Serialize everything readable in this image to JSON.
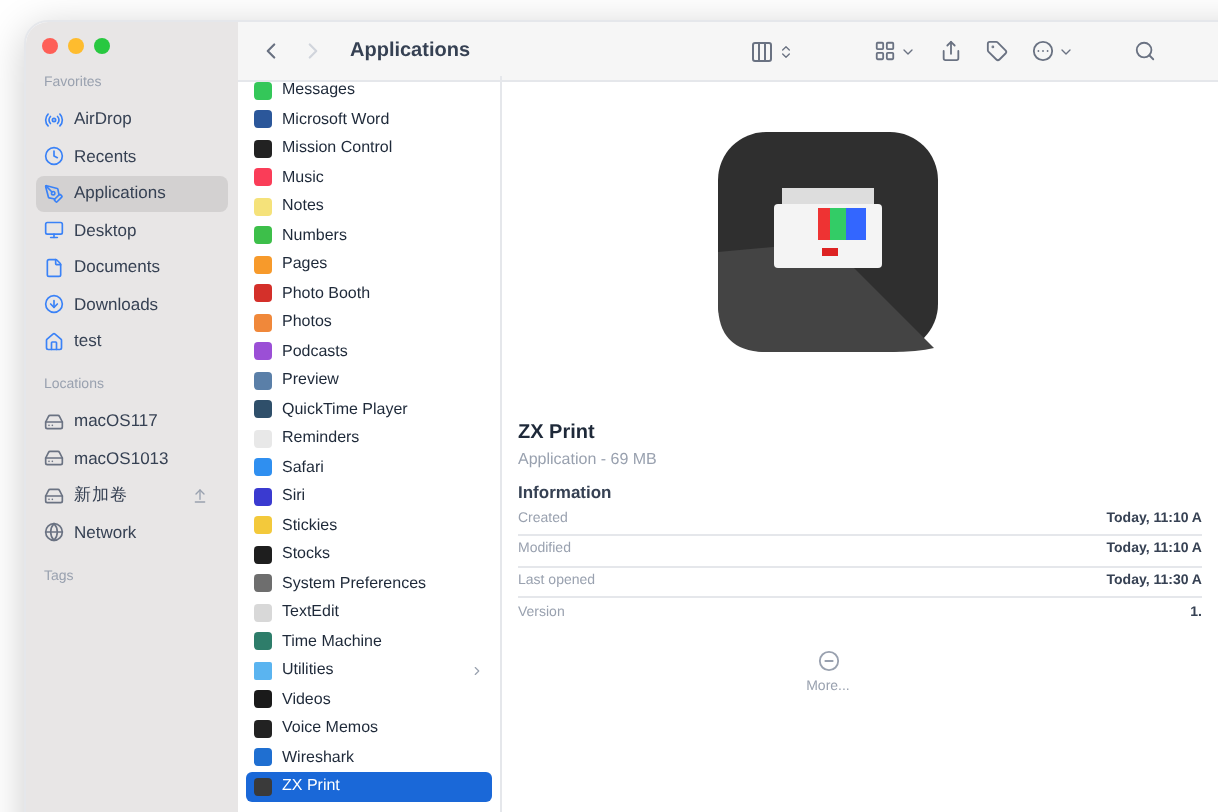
{
  "window": {
    "title": "Applications"
  },
  "sidebar": {
    "sections": [
      {
        "title": "Favorites",
        "items": [
          {
            "label": "AirDrop",
            "kind": "airdrop",
            "selected": false,
            "eject": false
          },
          {
            "label": "Recents",
            "kind": "recents",
            "selected": false,
            "eject": false
          },
          {
            "label": "Applications",
            "kind": "applications",
            "selected": true,
            "eject": false
          },
          {
            "label": "Desktop",
            "kind": "desktop",
            "selected": false,
            "eject": false
          },
          {
            "label": "Documents",
            "kind": "documents",
            "selected": false,
            "eject": false
          },
          {
            "label": "Downloads",
            "kind": "downloads",
            "selected": false,
            "eject": false
          },
          {
            "label": "test",
            "kind": "home",
            "selected": false,
            "eject": false
          }
        ]
      },
      {
        "title": "Locations",
        "items": [
          {
            "label": "macOS117",
            "kind": "disk",
            "selected": false,
            "eject": false
          },
          {
            "label": "macOS1013",
            "kind": "disk",
            "selected": false,
            "eject": false
          },
          {
            "label": "新加卷",
            "kind": "disk",
            "selected": false,
            "eject": true
          },
          {
            "label": "Network",
            "kind": "network",
            "selected": false,
            "eject": false
          }
        ]
      },
      {
        "title": "Tags"
      }
    ]
  },
  "files": [
    {
      "name": "Messages",
      "kind": "app",
      "color": "#34c759",
      "selected": false
    },
    {
      "name": "Microsoft Word",
      "kind": "app",
      "color": "#2b579a",
      "selected": false
    },
    {
      "name": "Mission Control",
      "kind": "app",
      "color": "#222222",
      "selected": false
    },
    {
      "name": "Music",
      "kind": "app",
      "color": "#fa3d58",
      "selected": false
    },
    {
      "name": "Notes",
      "kind": "app",
      "color": "#f5e27a",
      "selected": false
    },
    {
      "name": "Numbers",
      "kind": "app",
      "color": "#3dbf4a",
      "selected": false
    },
    {
      "name": "Pages",
      "kind": "app",
      "color": "#f79a2b",
      "selected": false
    },
    {
      "name": "Photo Booth",
      "kind": "app",
      "color": "#d4302a",
      "selected": false
    },
    {
      "name": "Photos",
      "kind": "app",
      "color": "#f0883a",
      "selected": false
    },
    {
      "name": "Podcasts",
      "kind": "app",
      "color": "#9b4fd6",
      "selected": false
    },
    {
      "name": "Preview",
      "kind": "app",
      "color": "#5a7fa8",
      "selected": false
    },
    {
      "name": "QuickTime Player",
      "kind": "app",
      "color": "#2f4f6a",
      "selected": false
    },
    {
      "name": "Reminders",
      "kind": "app",
      "color": "#e8e8e8",
      "selected": false
    },
    {
      "name": "Safari",
      "kind": "app",
      "color": "#2f8ff0",
      "selected": false
    },
    {
      "name": "Siri",
      "kind": "app",
      "color": "#3a3ad0",
      "selected": false
    },
    {
      "name": "Stickies",
      "kind": "app",
      "color": "#f3c93b",
      "selected": false
    },
    {
      "name": "Stocks",
      "kind": "app",
      "color": "#1e1e1e",
      "selected": false
    },
    {
      "name": "System Preferences",
      "kind": "app",
      "color": "#6e6e6e",
      "selected": false
    },
    {
      "name": "TextEdit",
      "kind": "app",
      "color": "#d8d8d8",
      "selected": false
    },
    {
      "name": "Time Machine",
      "kind": "app",
      "color": "#2e7d6a",
      "selected": false
    },
    {
      "name": "Utilities",
      "kind": "folder",
      "color": "#5ab4f0",
      "selected": false
    },
    {
      "name": "Videos",
      "kind": "app",
      "color": "#1a1a1a",
      "selected": false
    },
    {
      "name": "Voice Memos",
      "kind": "app",
      "color": "#222222",
      "selected": false
    },
    {
      "name": "Wireshark",
      "kind": "app",
      "color": "#1f6fd1",
      "selected": false
    },
    {
      "name": "ZX Print",
      "kind": "app",
      "color": "#3a3a3a",
      "selected": true
    }
  ],
  "preview": {
    "name": "ZX Print",
    "subtitle": "Application - 69 MB",
    "section": "Information",
    "rows": [
      {
        "label": "Created",
        "value": "Today, 11:10 A"
      },
      {
        "label": "Modified",
        "value": "Today, 11:10 A"
      },
      {
        "label": "Last opened",
        "value": "Today, 11:30 A"
      },
      {
        "label": "Version",
        "value": "1."
      }
    ],
    "more": "More..."
  }
}
